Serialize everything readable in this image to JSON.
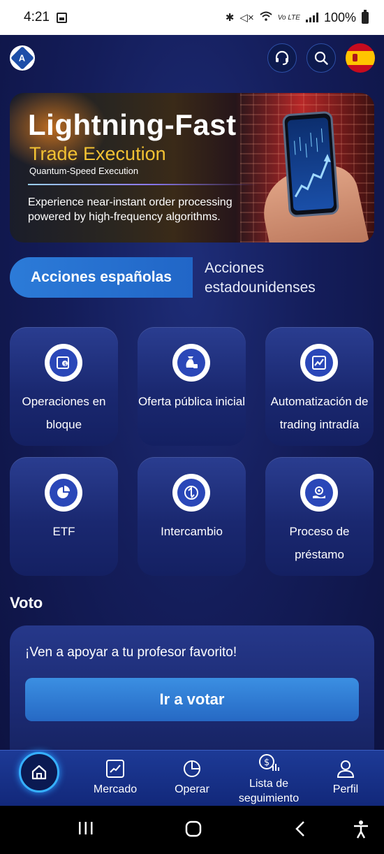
{
  "status_bar": {
    "time": "4:21",
    "network_label": "Vo LTE",
    "battery": "100%"
  },
  "topbar": {
    "logo_letter": "A",
    "icons": [
      "headset-icon",
      "search-icon",
      "spain-flag-icon"
    ]
  },
  "banner": {
    "title": "Lightning-Fast",
    "subtitle": "Trade Execution",
    "subtitle2": "Quantum-Speed Execution",
    "description": "Experience near-instant order processing powered by high-frequency algorithms."
  },
  "tabs": [
    {
      "label": "Acciones españolas",
      "active": true
    },
    {
      "label": "Acciones estadounidenses",
      "active": false
    }
  ],
  "features": [
    {
      "label": "Operaciones en bloque",
      "icon": "block-trade-icon"
    },
    {
      "label": "Oferta pública inicial",
      "icon": "money-bag-icon"
    },
    {
      "label": "Automatización de trading intradía",
      "icon": "trend-chart-icon"
    },
    {
      "label": "ETF",
      "icon": "pie-chart-icon"
    },
    {
      "label": "Intercambio",
      "icon": "exchange-icon"
    },
    {
      "label": "Proceso de préstamo",
      "icon": "loan-hand-icon"
    }
  ],
  "voto": {
    "title": "Voto",
    "text": "¡Ven a apoyar a tu profesor favorito!",
    "button": "Ir a votar"
  },
  "bottom_nav": [
    {
      "label": "",
      "icon": "home-icon"
    },
    {
      "label": "Mercado",
      "icon": "market-chart-icon"
    },
    {
      "label": "Operar",
      "icon": "pie-icon"
    },
    {
      "label": "Lista de seguimiento",
      "icon": "watchlist-dollar-icon"
    },
    {
      "label": "Perfil",
      "icon": "person-icon"
    }
  ],
  "colors": {
    "background": "#141d5a",
    "accent": "#2c7bd8",
    "banner_gold": "#f2c233"
  }
}
